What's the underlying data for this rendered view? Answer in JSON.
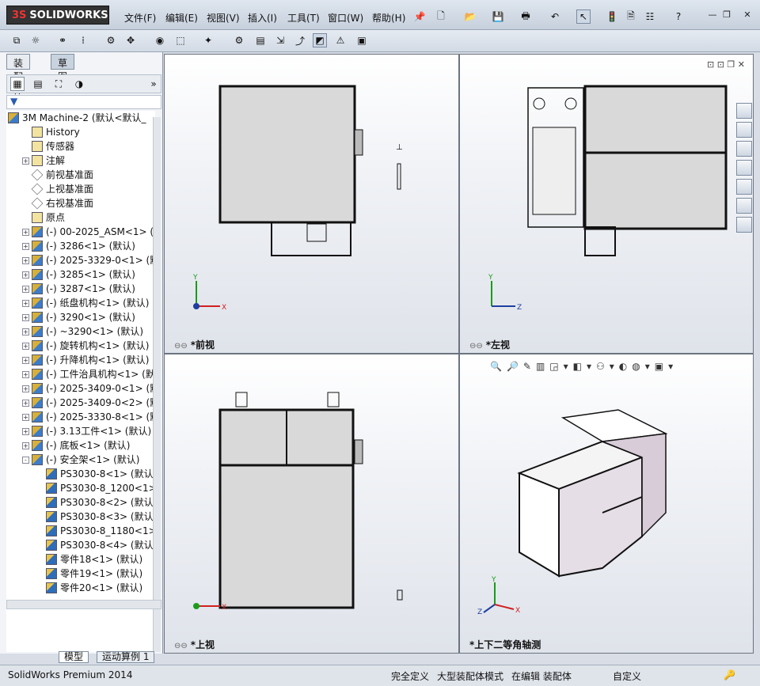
{
  "app": {
    "logo_text": "SOLIDWORKS",
    "logo_mark": "3S",
    "status_product": "SolidWorks Premium 2014"
  },
  "menu": [
    "文件(F)",
    "编辑(E)",
    "视图(V)",
    "插入(I)",
    "工具(T)",
    "窗口(W)",
    "帮助(H)"
  ],
  "panel": {
    "tabs": [
      "装配体",
      "草图"
    ],
    "bottom_tabs": [
      "模型",
      "运动算例 1"
    ],
    "filter_icon": "filter-icon"
  },
  "tree": [
    {
      "label": "3M Machine-2  (默认<默认_",
      "icon": "assembly",
      "expand": "",
      "indent": 0
    },
    {
      "label": "History",
      "icon": "history",
      "expand": "",
      "indent": 1
    },
    {
      "label": "传感器",
      "icon": "sensor",
      "expand": "",
      "indent": 1
    },
    {
      "label": "注解",
      "icon": "annotation",
      "expand": "+",
      "indent": 1
    },
    {
      "label": "前视基准面",
      "icon": "plane",
      "expand": "",
      "indent": 1
    },
    {
      "label": "上视基准面",
      "icon": "plane",
      "expand": "",
      "indent": 1
    },
    {
      "label": "右视基准面",
      "icon": "plane",
      "expand": "",
      "indent": 1
    },
    {
      "label": "原点",
      "icon": "origin",
      "expand": "",
      "indent": 1
    },
    {
      "label": "(-) 00-2025_ASM<1> (默",
      "icon": "asm",
      "expand": "+",
      "indent": 1
    },
    {
      "label": "(-) 3286<1> (默认)",
      "icon": "asm",
      "expand": "+",
      "indent": 1
    },
    {
      "label": "(-) 2025-3329-0<1> (默认",
      "icon": "asm",
      "expand": "+",
      "indent": 1
    },
    {
      "label": "(-) 3285<1> (默认)",
      "icon": "asm",
      "expand": "+",
      "indent": 1
    },
    {
      "label": "(-) 3287<1> (默认)",
      "icon": "asm",
      "expand": "+",
      "indent": 1
    },
    {
      "label": "(-) 纸盘机构<1> (默认)",
      "icon": "asm",
      "expand": "+",
      "indent": 1
    },
    {
      "label": "(-) 3290<1> (默认)",
      "icon": "asm",
      "expand": "+",
      "indent": 1
    },
    {
      "label": "(-) ~3290<1> (默认)",
      "icon": "asm",
      "expand": "+",
      "indent": 1
    },
    {
      "label": "(-) 旋转机构<1> (默认)",
      "icon": "asm",
      "expand": "+",
      "indent": 1
    },
    {
      "label": "(-) 升降机构<1> (默认)",
      "icon": "asm",
      "expand": "+",
      "indent": 1
    },
    {
      "label": "(-) 工件治具机构<1> (默认",
      "icon": "asm",
      "expand": "+",
      "indent": 1
    },
    {
      "label": "(-) 2025-3409-0<1> (默认",
      "icon": "asm",
      "expand": "+",
      "indent": 1
    },
    {
      "label": "(-) 2025-3409-0<2> (默认",
      "icon": "asm",
      "expand": "+",
      "indent": 1
    },
    {
      "label": "(-) 2025-3330-8<1> (默认",
      "icon": "asm",
      "expand": "+",
      "indent": 1
    },
    {
      "label": "(-) 3.13工件<1> (默认)",
      "icon": "asm",
      "expand": "+",
      "indent": 1
    },
    {
      "label": "(-) 底板<1> (默认)",
      "icon": "asm",
      "expand": "+",
      "indent": 1
    },
    {
      "label": "(-) 安全架<1> (默认)",
      "icon": "asm",
      "expand": "-",
      "indent": 1
    },
    {
      "label": "PS3030-8<1> (默认)",
      "icon": "part",
      "expand": "",
      "indent": 2
    },
    {
      "label": "PS3030-8_1200<1> (",
      "icon": "part",
      "expand": "",
      "indent": 2
    },
    {
      "label": "PS3030-8<2> (默认)",
      "icon": "part",
      "expand": "",
      "indent": 2
    },
    {
      "label": "PS3030-8<3> (默认)",
      "icon": "part",
      "expand": "",
      "indent": 2
    },
    {
      "label": "PS3030-8_1180<1> (",
      "icon": "part",
      "expand": "",
      "indent": 2
    },
    {
      "label": "PS3030-8<4> (默认)",
      "icon": "part",
      "expand": "",
      "indent": 2
    },
    {
      "label": "零件18<1> (默认)",
      "icon": "part",
      "expand": "",
      "indent": 2
    },
    {
      "label": "零件19<1> (默认)",
      "icon": "part",
      "expand": "",
      "indent": 2
    },
    {
      "label": "零件20<1> (默认)",
      "icon": "part",
      "expand": "",
      "indent": 2
    }
  ],
  "viewports": {
    "front": "*前视",
    "left": "*左视",
    "top": "*上视",
    "iso": "*上下二等角轴测"
  },
  "axes": {
    "x": "X",
    "y": "Y",
    "z": "Z"
  },
  "status": {
    "defined": "完全定义",
    "mode": "大型装配体模式",
    "editing": "在编辑 装配体",
    "custom": "自定义"
  }
}
